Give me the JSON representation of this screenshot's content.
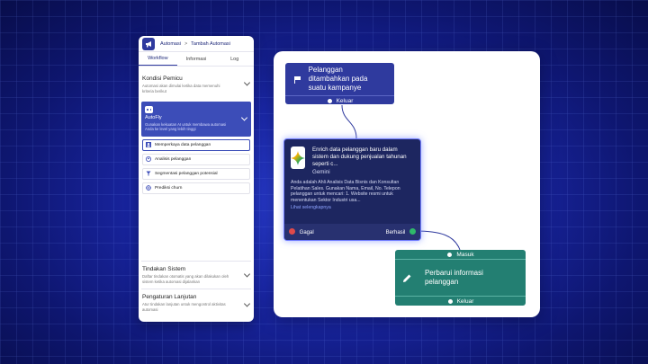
{
  "header": {
    "crumb_root": "Automasi",
    "crumb_sep": ">",
    "crumb_current": "Tambah Automasi"
  },
  "tabs": [
    {
      "label": "Workflow"
    },
    {
      "label": "Informasi"
    },
    {
      "label": "Log"
    }
  ],
  "trigger_section": {
    "title": "Kondisi Pemicu",
    "desc": "Automasi akan dimulai ketika data memenuhi kriteria berikut"
  },
  "autofly": {
    "title": "AutoFly",
    "desc": "Gunakan kekuatan AI untuk membawa automasi Anda ke level yang lebih tinggi",
    "options": [
      {
        "label": "Memperkaya data pelanggan",
        "icon": "person-icon"
      },
      {
        "label": "Analisis pelanggan",
        "icon": "user-circle-icon"
      },
      {
        "label": "Segmentasi pelanggan potensial",
        "icon": "funnel-icon"
      },
      {
        "label": "Prediksi churn",
        "icon": "target-icon"
      }
    ]
  },
  "system_section": {
    "title": "Tindakan Sistem",
    "desc": "Daftar tindakan otomatis yang akan dilakukan oleh sistem ketika automasi dijalankan"
  },
  "advanced_section": {
    "title": "Pengaturan Lanjutan",
    "desc": "Atur tindakan lanjutan untuk mengontrol aktivitas automasi"
  },
  "trigger_node": {
    "title": "Pelanggan ditambahkan pada suatu kampanye",
    "exit": "Keluar",
    "icon": "flag-icon"
  },
  "ai_node": {
    "title": "Enrich data pelanggan baru dalam sistem dan dukung penjualan tahunan seperti c...",
    "model": "Gemini",
    "desc": "Anda adalah Ahli Analisis Data Bisnis dan Konsultan Pelatihan Sales. Gunakan Nama, Email, No. Telepon pelanggan untuk mencari: 1. Website resmi untuk menentukan Sektor Industri usa...",
    "link": "Lihat selengkapnya",
    "fail": "Gagal",
    "success": "Berhasil",
    "fail_color": "#e04a4a",
    "success_color": "#2fb86a"
  },
  "action_node": {
    "enter": "Masuk",
    "title": "Perbarui informasi pelanggan",
    "exit": "Keluar",
    "icon": "pencil-icon"
  },
  "colors": {
    "primary": "#2f3a9e",
    "action": "#237f72",
    "ai_bg": "#1d2660"
  }
}
